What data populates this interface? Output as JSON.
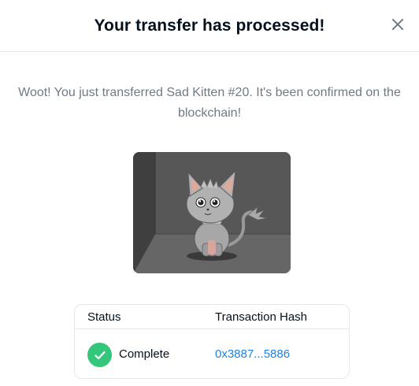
{
  "modal": {
    "title": "Your transfer has processed!",
    "close_icon": "close-icon",
    "message": "Woot! You just transferred Sad Kitten #20. It's been confirmed on the blockchain!"
  },
  "nft": {
    "name": "Sad Kitten #20",
    "image_icon": "cartoon-gray-kitten-image"
  },
  "transaction": {
    "headers": {
      "status": "Status",
      "hash": "Transaction Hash"
    },
    "status_value": "Complete",
    "status_icon": "check-circle-icon",
    "status_color": "#34c77b",
    "hash_value": "0x3887...5886",
    "link_color": "#2081e2"
  }
}
